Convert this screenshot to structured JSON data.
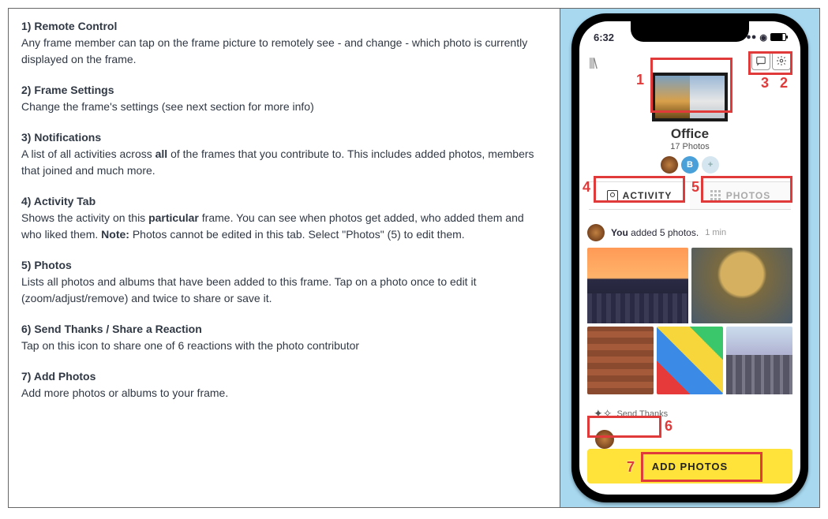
{
  "sections": [
    {
      "num": "1)",
      "title": "Remote Control",
      "body_pre": "Any frame member can tap on the frame picture to remotely see - and change - which photo is currently displayed on the frame.",
      "bold_mid": "",
      "body_post": ""
    },
    {
      "num": "2)",
      "title": "Frame Settings",
      "body_pre": "Change the frame's settings (see next section for more info)",
      "bold_mid": "",
      "body_post": ""
    },
    {
      "num": "3)",
      "title": "Notifications",
      "body_pre": "A list of all activities across ",
      "bold_mid": "all",
      "body_post": " of the frames that you contribute to. This includes added photos, members that joined and much more."
    },
    {
      "num": "4)",
      "title": "Activity Tab",
      "body_pre": "Shows the activity on this ",
      "bold_mid": "particular",
      "body_post": " frame. You can see when photos get added, who added them and who liked them. ",
      "note_label": "Note:",
      "note_text": " Photos cannot be edited in this tab. Select \"Photos\" (5) to edit them."
    },
    {
      "num": "5)",
      "title": "Photos",
      "body_pre": "Lists all photos and albums that have been added to this frame. Tap on a photo once to edit it (zoom/adjust/remove) and twice to share or save it.",
      "bold_mid": "",
      "body_post": ""
    },
    {
      "num": "6)",
      "title": "Send Thanks / Share a Reaction",
      "body_pre": "Tap on this icon to share one of 6 reactions with the photo contributor",
      "bold_mid": "",
      "body_post": ""
    },
    {
      "num": "7)",
      "title": "Add Photos",
      "body_pre": "Add more photos or albums to your frame.",
      "bold_mid": "",
      "body_post": ""
    }
  ],
  "phone": {
    "time": "6:32",
    "frame_name": "Office",
    "frame_subtitle": "17 Photos",
    "avatar_b_letter": "B",
    "avatar_plus": "+",
    "tab_activity": "ACTIVITY",
    "tab_photos": "PHOTOS",
    "feed_you": "You",
    "feed_action": " added 5 photos.",
    "feed_time": "1 min",
    "send_thanks": "Send Thanks",
    "add_photos": "ADD PHOTOS"
  },
  "callouts": {
    "n1": "1",
    "n2": "2",
    "n3": "3",
    "n4": "4",
    "n5": "5",
    "n6": "6",
    "n7": "7"
  }
}
